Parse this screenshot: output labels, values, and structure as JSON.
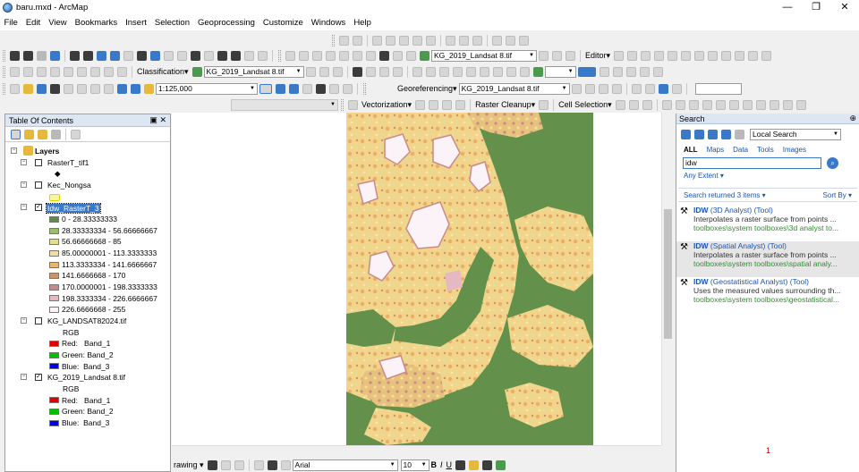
{
  "window": {
    "title": "baru.mxd - ArcMap",
    "minimize": "—",
    "restore": "❐",
    "close": "✕"
  },
  "menu": [
    "File",
    "Edit",
    "View",
    "Bookmarks",
    "Insert",
    "Selection",
    "Geoprocessing",
    "Customize",
    "Windows",
    "Help"
  ],
  "toolbar": {
    "layer_combo1": "KG_2019_Landsat 8.tif",
    "editor": "Editor▾",
    "classification": "Classification▾",
    "layer_combo2": "KG_2019_Landsat 8.tif",
    "scale": "1:125,000",
    "georeferencing": "Georeferencing▾",
    "geo_layer": "KG_2019_Landsat 8.tif",
    "vectorization": "Vectorization▾",
    "raster_cleanup": "Raster Cleanup▾",
    "cell_selection": "Cell Selection▾"
  },
  "toc": {
    "title": "Table Of Contents",
    "pin": "▣",
    "close": "✕",
    "layers_label": "Layers",
    "layers": [
      {
        "name": "RasterT_tif1",
        "checked": false,
        "legend": [
          {
            "label": "◆",
            "color": ""
          }
        ]
      },
      {
        "name": "Kec_Nongsa",
        "checked": false,
        "legend": [
          {
            "label": "",
            "color": "#f5f5a0"
          }
        ]
      },
      {
        "name": "Idw_RasterT_3",
        "checked": true,
        "selected": true,
        "legend": [
          {
            "label": "0 - 28.33333333",
            "color": "#5f8c45"
          },
          {
            "label": "28.33333334 - 56.66666667",
            "color": "#9dbd6a"
          },
          {
            "label": "56.66666668 - 85",
            "color": "#dde096"
          },
          {
            "label": "85.00000001 - 113.3333333",
            "color": "#f5dd9a"
          },
          {
            "label": "113.3333334 - 141.6666667",
            "color": "#e8b670"
          },
          {
            "label": "141.6666668 - 170",
            "color": "#cc9466"
          },
          {
            "label": "170.0000001 - 198.3333333",
            "color": "#c98a8a"
          },
          {
            "label": "198.3333334 - 226.6666667",
            "color": "#e6b8c2"
          },
          {
            "label": "226.6666668 - 255",
            "color": "#fbf3f8"
          }
        ]
      },
      {
        "name": "KG_LANDSAT82024.tif",
        "checked": false,
        "legend": [
          {
            "label": "RGB",
            "color": ""
          },
          {
            "label": "Red:   Band_1",
            "color": "#e00000"
          },
          {
            "label": "Green: Band_2",
            "color": "#00c000"
          },
          {
            "label": "Blue:  Band_3",
            "color": "#0000e0"
          }
        ]
      },
      {
        "name": "KG_2019_Landsat 8.tif",
        "checked": true,
        "legend": [
          {
            "label": "RGB",
            "color": ""
          },
          {
            "label": "Red:   Band_1",
            "color": "#e00000"
          },
          {
            "label": "Green: Band_2",
            "color": "#00c000"
          },
          {
            "label": "Blue:  Band_3",
            "color": "#0000e0"
          }
        ]
      }
    ]
  },
  "search": {
    "title": "Search",
    "pin": "⊕",
    "scope": "Local Search",
    "tabs": [
      "ALL",
      "Maps",
      "Data",
      "Tools",
      "Images"
    ],
    "query": "idw",
    "extent": "Any Extent ▾",
    "returned": "Search returned 3 items ▾",
    "sort": "Sort By ▾",
    "results": [
      {
        "name": "IDW",
        "kind": "(3D Analyst)",
        "type": "(Tool)",
        "desc": "Interpolates a raster surface from points ...",
        "path": "toolboxes\\system toolboxes\\3d analyst to..."
      },
      {
        "name": "IDW",
        "kind": "(Spatial Analyst)",
        "type": "(Tool)",
        "desc": "Interpolates a raster surface from points ...",
        "path": "toolboxes\\system toolboxes\\spatial analy..."
      },
      {
        "name": "IDW",
        "kind": "(Geostatistical Analyst)",
        "type": "(Tool)",
        "desc": "Uses the measured values surrounding th...",
        "path": "toolboxes\\system toolboxes\\geostatistical..."
      }
    ],
    "page": "1"
  },
  "drawing": {
    "label": "rawing ▾",
    "font": "Arial",
    "size": "10",
    "bold": "B",
    "italic": "I",
    "underline": "U"
  }
}
